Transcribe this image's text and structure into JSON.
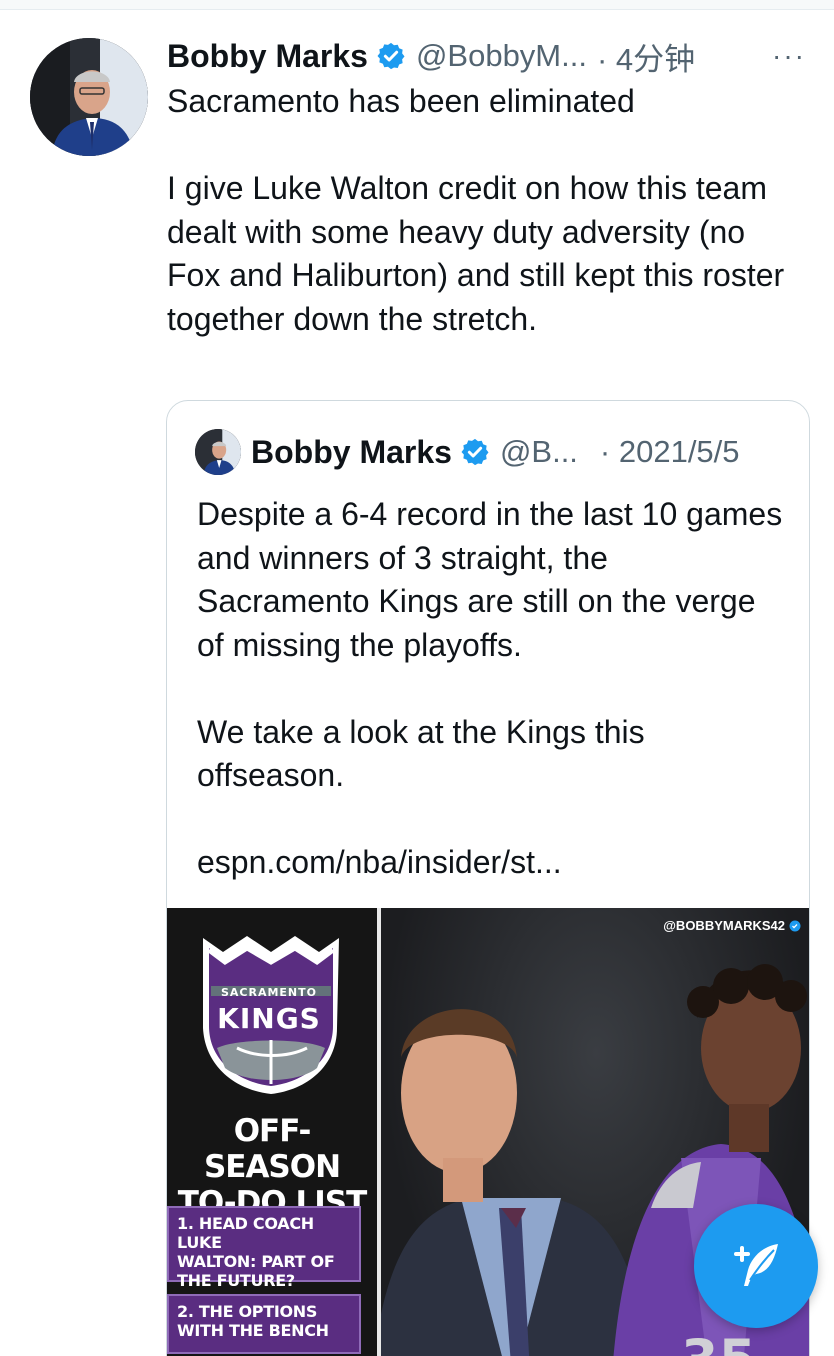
{
  "tweet": {
    "author_name": "Bobby Marks",
    "handle": "@BobbyM...",
    "time": "· 4分钟",
    "more_label": "···",
    "text": "Sacramento has been eliminated\n\nI give Luke Walton credit on how this team dealt with some heavy duty adversity (no Fox and Haliburton) and still kept this roster together down the stretch."
  },
  "quoted": {
    "author_name": "Bobby Marks",
    "handle": "@B...",
    "time": "· 2021/5/5",
    "text": "Despite a 6-4 record in the last 10 games and winners of 3 straight, the Sacramento Kings are still on the verge of missing the playoffs.\n\nWe take a look at the Kings this offseason.\n\nespn.com/nba/insider/st..."
  },
  "media": {
    "watermark": "@BOBBYMARKS42",
    "logo_top": "SACRAMENTO",
    "logo_main": "KINGS",
    "title": "OFF-SEASON\nTO-DO LIST",
    "items": [
      "1. HEAD COACH LUKE\nWALTON: PART OF\nTHE FUTURE?",
      "2. THE OPTIONS\nWITH THE BENCH"
    ]
  },
  "colors": {
    "accent": "#1d9bf0",
    "kings_purple": "#5a2d81",
    "secondary_text": "#536471"
  },
  "icons": {
    "verified": "verified-badge-icon",
    "more": "more-options-icon",
    "compose": "compose-tweet-icon"
  }
}
